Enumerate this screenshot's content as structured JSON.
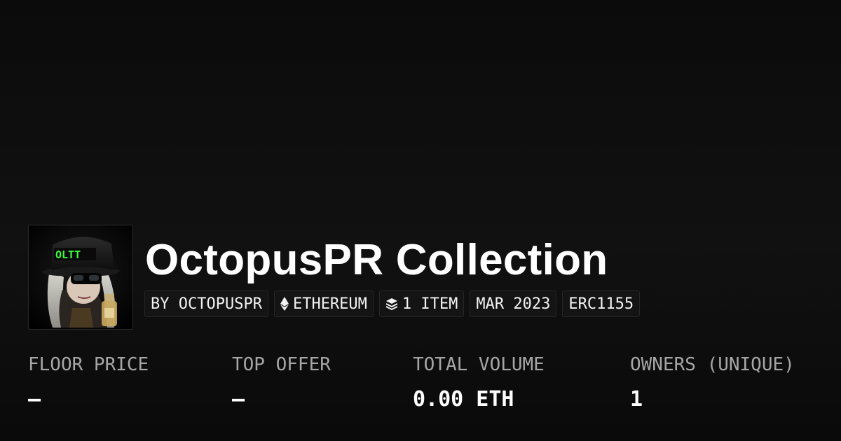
{
  "collection": {
    "title": "OctopusPR Collection",
    "avatar_text": "OLTT"
  },
  "chips": {
    "creator": "BY OCTOPUSPR",
    "chain": "ETHEREUM",
    "items": "1 ITEM",
    "date": "MAR 2023",
    "standard": "ERC1155"
  },
  "icons": {
    "chain": "ethereum-icon",
    "items": "layers-icon"
  },
  "stats": {
    "floor_price": {
      "label": "FLOOR PRICE",
      "value": "–"
    },
    "top_offer": {
      "label": "TOP OFFER",
      "value": "–"
    },
    "total_volume": {
      "label": "TOTAL VOLUME",
      "value": "0.00 ETH"
    },
    "owners": {
      "label": "OWNERS (UNIQUE)",
      "value": "1"
    }
  },
  "colors": {
    "background": "#0c0c0c",
    "chip_background": "#141414",
    "label": "#a6a6a6",
    "avatar_accent": "#3cff3c"
  }
}
